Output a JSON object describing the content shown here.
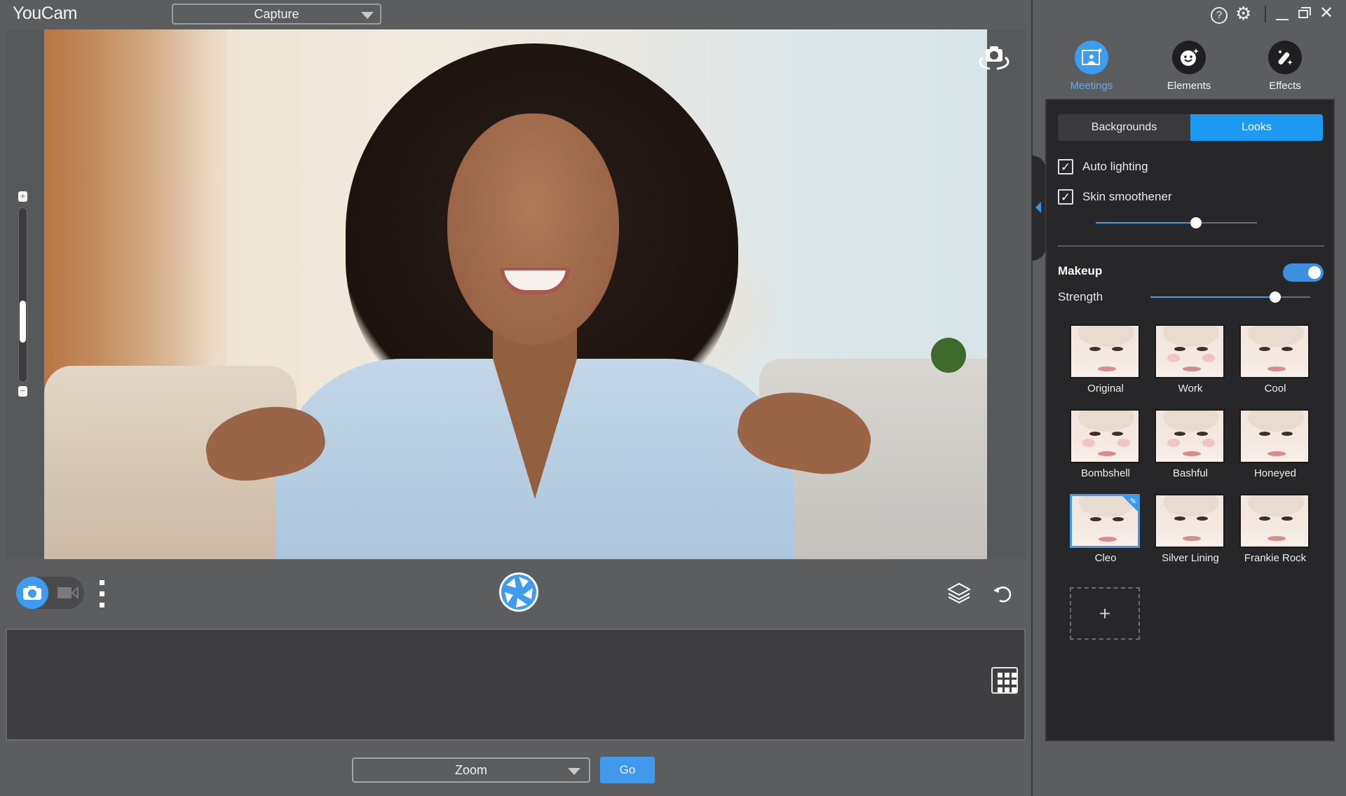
{
  "app": {
    "title": "YouCam"
  },
  "header": {
    "mode_select": {
      "value": "Capture"
    }
  },
  "window_controls": {
    "help_icon": "?",
    "settings_icon": "⚙",
    "close_icon": "✕"
  },
  "nav": {
    "tabs": [
      {
        "label": "Meetings",
        "icon": "meetings-icon",
        "active": true
      },
      {
        "label": "Elements",
        "icon": "smiley-icon",
        "active": false
      },
      {
        "label": "Effects",
        "icon": "magic-wand-icon",
        "active": false
      }
    ]
  },
  "panel": {
    "segments": [
      {
        "label": "Backgrounds",
        "active": false
      },
      {
        "label": "Looks",
        "active": true
      }
    ],
    "auto_lighting": {
      "label": "Auto lighting",
      "checked": true
    },
    "skin_smoothener": {
      "label": "Skin smoothener",
      "checked": true,
      "value": 0.62
    },
    "makeup": {
      "title": "Makeup",
      "enabled": true,
      "strength_label": "Strength",
      "strength": 0.78
    },
    "looks": [
      {
        "label": "Original",
        "selected": false
      },
      {
        "label": "Work",
        "selected": false
      },
      {
        "label": "Cool",
        "selected": false
      },
      {
        "label": "Bombshell",
        "selected": false
      },
      {
        "label": "Bashful",
        "selected": false
      },
      {
        "label": "Honeyed",
        "selected": false
      },
      {
        "label": "Cleo",
        "selected": true
      },
      {
        "label": "Silver Lining",
        "selected": false
      },
      {
        "label": "Frankie Rock",
        "selected": false
      }
    ],
    "add_look_label": "+"
  },
  "zoom_slider": {
    "plus": "+",
    "minus": "−",
    "value": 0.38
  },
  "controls": {
    "capture_mode": "photo"
  },
  "bottom": {
    "target_select": {
      "value": "Zoom"
    },
    "go_label": "Go"
  },
  "colors": {
    "accent": "#3d9bf0",
    "background": "#5c5d5f",
    "panel": "#272729"
  }
}
